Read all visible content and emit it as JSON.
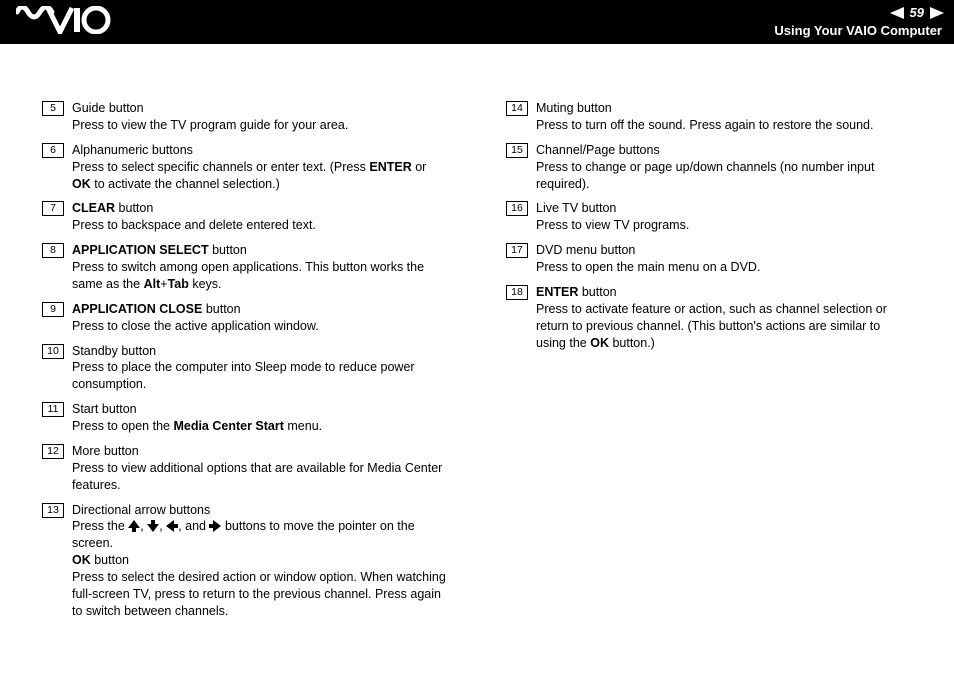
{
  "header": {
    "page_number": "59",
    "section": "Using Your VAIO Computer"
  },
  "left": [
    {
      "num": "5",
      "title_plain": "Guide button",
      "desc": "Press to view the TV program guide for your area."
    },
    {
      "num": "6",
      "title_plain": "Alphanumeric buttons",
      "desc_html": "Press to select specific channels or enter text. (Press <b>ENTER</b> or <b>OK</b> to activate the channel selection.)"
    },
    {
      "num": "7",
      "title_html": "<b>CLEAR</b> button",
      "desc": "Press to backspace and delete entered text."
    },
    {
      "num": "8",
      "title_html": "<b>APPLICATION SELECT</b> button",
      "desc_html": "Press to switch among open applications. This button works the same as the <b>Alt</b>+<b>Tab</b> keys."
    },
    {
      "num": "9",
      "title_html": "<b>APPLICATION CLOSE</b> button",
      "desc": "Press to close the active application window."
    },
    {
      "num": "10",
      "title_plain": "Standby button",
      "desc": "Press to place the computer into Sleep mode to reduce power consumption."
    },
    {
      "num": "11",
      "title_plain": "Start button",
      "desc_html": "Press to open the <b>Media Center Start</b> menu."
    },
    {
      "num": "12",
      "title_plain": "More button",
      "desc": "Press to view additional options that are available for Media Center features."
    },
    {
      "num": "13",
      "title_plain": "Directional arrow buttons",
      "desc_arrows_prefix": "Press the ",
      "desc_arrows_mid": ", and ",
      "desc_arrows_suffix": " buttons to move the pointer on the screen.",
      "sub_title_html": "<b>OK</b> button",
      "sub_desc": "Press to select the desired action or window option. When watching full-screen TV, press to return to the previous channel. Press again to switch between channels."
    }
  ],
  "right": [
    {
      "num": "14",
      "title_plain": "Muting button",
      "desc": "Press to turn off the sound. Press again to restore the sound."
    },
    {
      "num": "15",
      "title_plain": "Channel/Page buttons",
      "desc": "Press to change or page up/down channels (no number input required)."
    },
    {
      "num": "16",
      "title_plain": "Live TV button",
      "desc": "Press to view TV programs."
    },
    {
      "num": "17",
      "title_plain": "DVD menu button",
      "desc": "Press to open the main menu on a DVD."
    },
    {
      "num": "18",
      "title_html": "<b>ENTER</b> button",
      "desc_html": "Press to activate feature or action, such as channel selection or return to previous channel. (This button's actions are similar to using the <b>OK</b> button.)"
    }
  ]
}
